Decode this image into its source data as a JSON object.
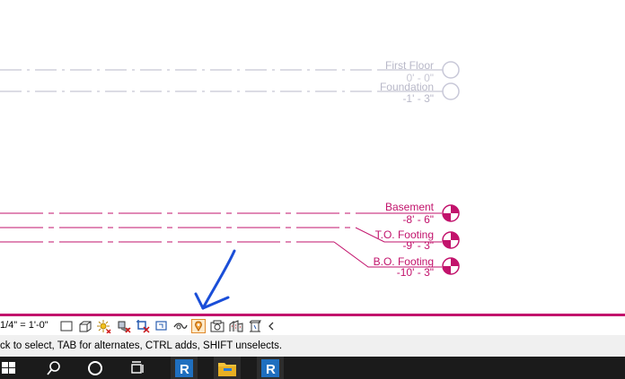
{
  "levels": {
    "first_floor": {
      "name": "First Floor",
      "elevation": "0' - 0\""
    },
    "foundation": {
      "name": "Foundation",
      "elevation": "-1' - 3\""
    },
    "basement": {
      "name": "Basement",
      "elevation": "-8' - 6\""
    },
    "to_footing": {
      "name": "T.O. Footing",
      "elevation": "-9' - 3\""
    },
    "bo_footing": {
      "name": "B.O. Footing",
      "elevation": "-10' - 3\""
    }
  },
  "colors": {
    "active_level": "#c2136c",
    "inactive_level": "#b8b8c8",
    "annotation_ink": "#1a4ed8",
    "taskbar": "#1b1b1b"
  },
  "view_control_bar": {
    "scale": "1/4\" = 1'-0\"",
    "icons": [
      "detail-level-icon",
      "visual-style-icon",
      "sun-path-icon",
      "shadows-icon",
      "crop-view-icon",
      "show-crop-region-icon",
      "unlock-3d-view-icon",
      "temporary-hide-icon",
      "reveal-hidden-icon",
      "temporary-view-properties-icon",
      "analytical-model-icon",
      "highlight-displacement-icon",
      "expand-icon"
    ]
  },
  "status_bar": {
    "message": "ck to select, TAB for alternates, CTRL adds, SHIFT unselects."
  },
  "taskbar": {
    "items": [
      "windows-start-icon",
      "search-icon",
      "cortana-icon",
      "task-view-icon",
      "revit-app-icon",
      "file-explorer-icon",
      "revit-app-icon-2"
    ]
  }
}
